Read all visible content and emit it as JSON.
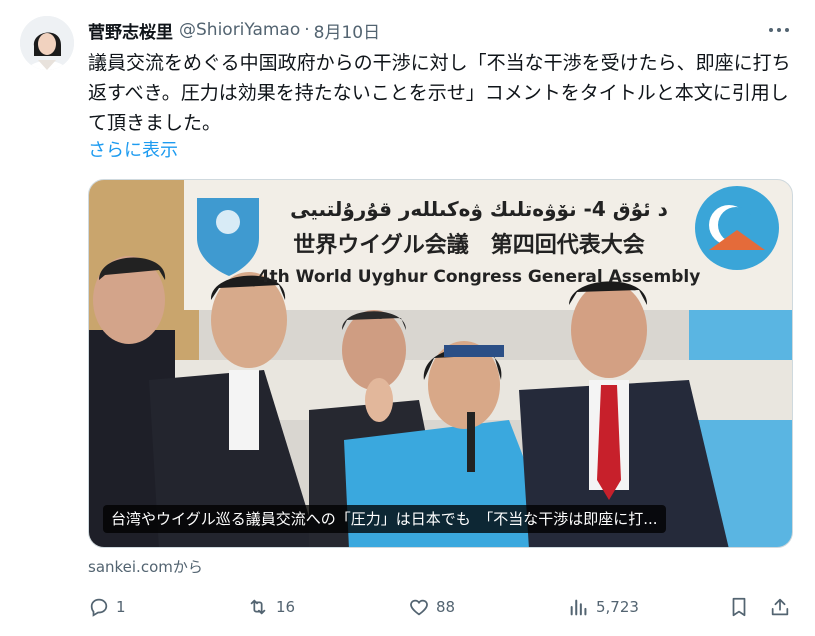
{
  "post": {
    "author_name": "菅野志桜里",
    "handle": "@ShioriYamao",
    "separator": "·",
    "date": "8月10日",
    "text": "議員交流をめぐる中国政府からの干渉に対し「不当な干渉を受けたら、即座に打ち返すべき。圧力は効果を持たないことを示せ」コメントをタイトルと本文に引用して頂きました。",
    "show_more": "さらに表示"
  },
  "card": {
    "caption": "台湾やウイグル巡る議員交流への「圧力」は日本でも　「不当な干渉は即座に打...",
    "banner_uyghur_text": "د ئۇق 4- نۆۋەتلىك ۋەكىللەر قۇرۇلتىيى",
    "banner_jp_text": "世界ウイグル会議　第四回代表大会",
    "banner_en_text": "4th World Uyghur Congress General Assembly",
    "source": "sankei.comから"
  },
  "actions": {
    "replies": "1",
    "reposts": "16",
    "likes": "88",
    "views": "5,723"
  },
  "icons": {
    "reply": "reply-icon",
    "repost": "repost-icon",
    "like": "heart-icon",
    "views": "views-icon",
    "bookmark": "bookmark-icon",
    "share": "share-icon",
    "more": "more-icon"
  },
  "colors": {
    "link": "#1d9bf0",
    "muted": "#536471",
    "text": "#0f1419"
  }
}
